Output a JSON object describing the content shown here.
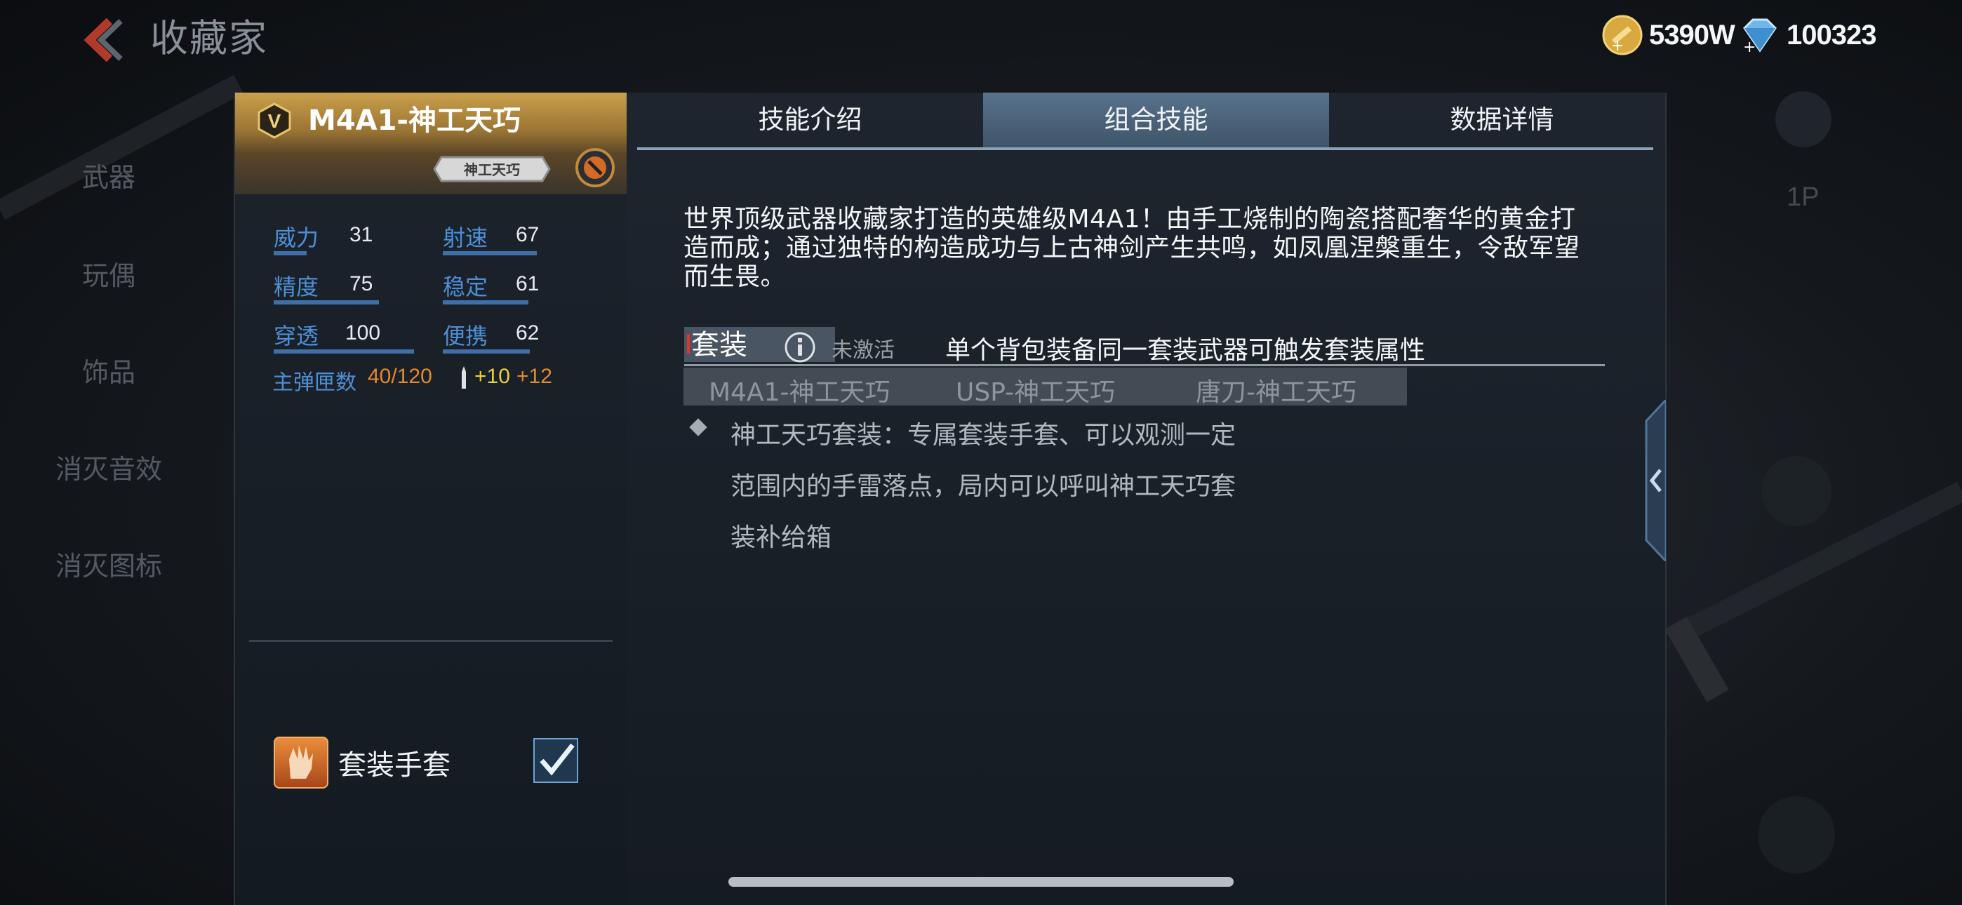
{
  "header": {
    "title": "收藏家"
  },
  "currency": {
    "gold": {
      "icon": "gold-coin-icon",
      "value": "5390W"
    },
    "diamond": {
      "icon": "diamond-icon",
      "value": "100323"
    }
  },
  "nav": {
    "items": [
      "武器",
      "玩偶",
      "饰品",
      "消灭音效",
      "消灭图标"
    ]
  },
  "side": {
    "label": "1P"
  },
  "weapon": {
    "name": "M4A1-神工天巧",
    "badge_logo": "神工天巧",
    "stats": [
      {
        "label": "威力",
        "value": "31",
        "fraction": 0.31
      },
      {
        "label": "射速",
        "value": "67",
        "fraction": 0.67
      },
      {
        "label": "精度",
        "value": "75",
        "fraction": 0.75
      },
      {
        "label": "稳定",
        "value": "61",
        "fraction": 0.61
      },
      {
        "label": "穿透",
        "value": "100",
        "fraction": 1.0
      },
      {
        "label": "便携",
        "value": "62",
        "fraction": 0.62
      }
    ],
    "ammo": {
      "label": "主弹匣数",
      "count": "40/120",
      "plus1": "+10",
      "plus2": "+12"
    },
    "glove": {
      "label": "套装手套",
      "checked": true
    }
  },
  "tabs": [
    {
      "label": "技能介绍",
      "active": false
    },
    {
      "label": "组合技能",
      "active": true
    },
    {
      "label": "数据详情",
      "active": false
    }
  ],
  "description": "世界顶级武器收藏家打造的英雄级M4A1！由手工烧制的陶瓷搭配奢华的黄金打造而成；通过独特的构造成功与上古神剑产生共鸣，如凤凰涅槃重生，令敌军望而生畏。",
  "suit": {
    "label": "套装",
    "status": "未激活",
    "description": "单个背包装备同一套装武器可触发套装属性",
    "members": [
      "M4A1-神工天巧",
      "USP-神工天巧",
      "唐刀-神工天巧"
    ],
    "effect_lines": [
      "神工天巧套装：专属套装手套、可以观测一定",
      "范围内的手雷落点，局内可以呼叫神工天巧套",
      "装补给箱"
    ]
  },
  "colors": {
    "accent_blue": "#4e8fd6",
    "ammo_orange": "#e58a2a",
    "ammo_yellow": "#e9d33a",
    "gold_header": "#caa04c"
  }
}
